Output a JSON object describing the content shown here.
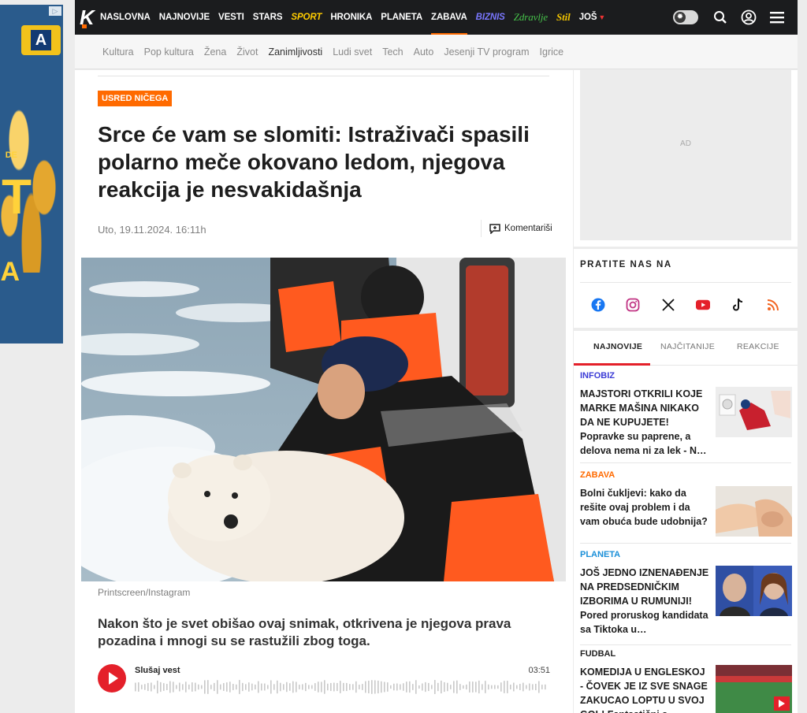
{
  "ad_left": {
    "badge": "▷",
    "brand_letter": "A",
    "small_text": "DE",
    "big_letter": "T",
    "big_sub": "A"
  },
  "nav": {
    "logo": "K",
    "items": [
      "NASLOVNA",
      "NAJNOVIJE",
      "VESTI",
      "STARS",
      "SPORT",
      "HRONIKA",
      "PLANETA",
      "ZABAVA",
      "BIZNIS",
      "Zdravlje",
      "Stil",
      "JOŠ"
    ],
    "active": "ZABAVA",
    "toggle_icon": "sun-icon"
  },
  "subnav": {
    "items": [
      "Kultura",
      "Pop kultura",
      "Žena",
      "Život",
      "Zanimljivosti",
      "Ludi svet",
      "Tech",
      "Auto",
      "Jesenji TV program",
      "Igrice"
    ],
    "active": "Zanimljivosti"
  },
  "article": {
    "category": "USRED NIČEGA",
    "headline": "Srce će vam se slomiti: Istraživači spasili polarno meče okovano ledom, njegova reakcija je nesvakidašnja",
    "date": "Uto, 19.11.2024. 16:11h",
    "comments_label": "Komentariši",
    "photo_caption": "Printscreen/Instagram",
    "lead": "Nakon što je svet obišao ovaj snimak, otkrivena je njegova prava pozadina i mnogi su se rastužili zbog toga.",
    "audio": {
      "title": "Slušaj vest",
      "duration": "03:51"
    }
  },
  "ad_right": {
    "label": "AD"
  },
  "follow": {
    "title": "PRATITE NAS NA",
    "networks": [
      "facebook-icon",
      "instagram-icon",
      "x-icon",
      "youtube-icon",
      "tiktok-icon",
      "rss-icon"
    ],
    "colors": {
      "facebook": "#1877f2",
      "instagram": "#c13584",
      "x": "#111111",
      "youtube": "#e4202a",
      "tiktok": "#111111",
      "rss": "#f26522"
    }
  },
  "latest": {
    "tabs": [
      "NAJNOVIJE",
      "NAJČITANIJE",
      "REAKCIJE"
    ],
    "active_tab": "NAJNOVIJE",
    "items": [
      {
        "category": "INFOBIZ",
        "category_color": "#3b3bd6",
        "title": "MAJSTORI OTKRILI KOJE MARKE MAŠINA NIKAKO DA NE KUPUJETE! Popravke su paprene, a delova nema ni za lek - N…"
      },
      {
        "category": "ZABAVA",
        "category_color": "#ff6a00",
        "title": "Bolni čukljevi: kako da rešite ovaj problem i da vam obuća bude udobnija?"
      },
      {
        "category": "PLANETA",
        "category_color": "#1a8fd8",
        "title": "JOŠ JEDNO IZNENAĐENJE NA PREDSEDNIČKIM IZBORIMA U RUMUNIJI! Pored proruskog kandidata sa Tiktoka u…"
      },
      {
        "category": "FUDBAL",
        "category_color": "#222222",
        "title": "KOMEDIJA U ENGLESKOJ - ČOVEK JE IZ SVE SNAGE ZAKUCAO LOPTU U SVOJ GOL! Fantastični s…"
      }
    ]
  }
}
